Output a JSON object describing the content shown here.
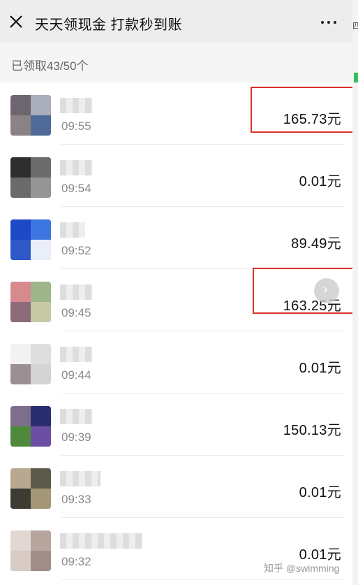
{
  "header": {
    "title": "天天领现金 打款秒到账"
  },
  "summary": "已领取43/50个",
  "rows": [
    {
      "time": "09:55",
      "amount": "165.73元"
    },
    {
      "time": "09:54",
      "amount": "0.01元"
    },
    {
      "time": "09:52",
      "amount": "89.49元"
    },
    {
      "time": "09:45",
      "amount": "163.25元"
    },
    {
      "time": "09:44",
      "amount": "0.01元"
    },
    {
      "time": "09:39",
      "amount": "150.13元"
    },
    {
      "time": "09:33",
      "amount": "0.01元"
    },
    {
      "time": "09:32",
      "amount": "0.01元"
    }
  ],
  "watermark": "知乎 @swimming",
  "side_strip_text": "四",
  "colors": {
    "highlight": "#d9312b",
    "accent_green": "#2fbf5a"
  }
}
